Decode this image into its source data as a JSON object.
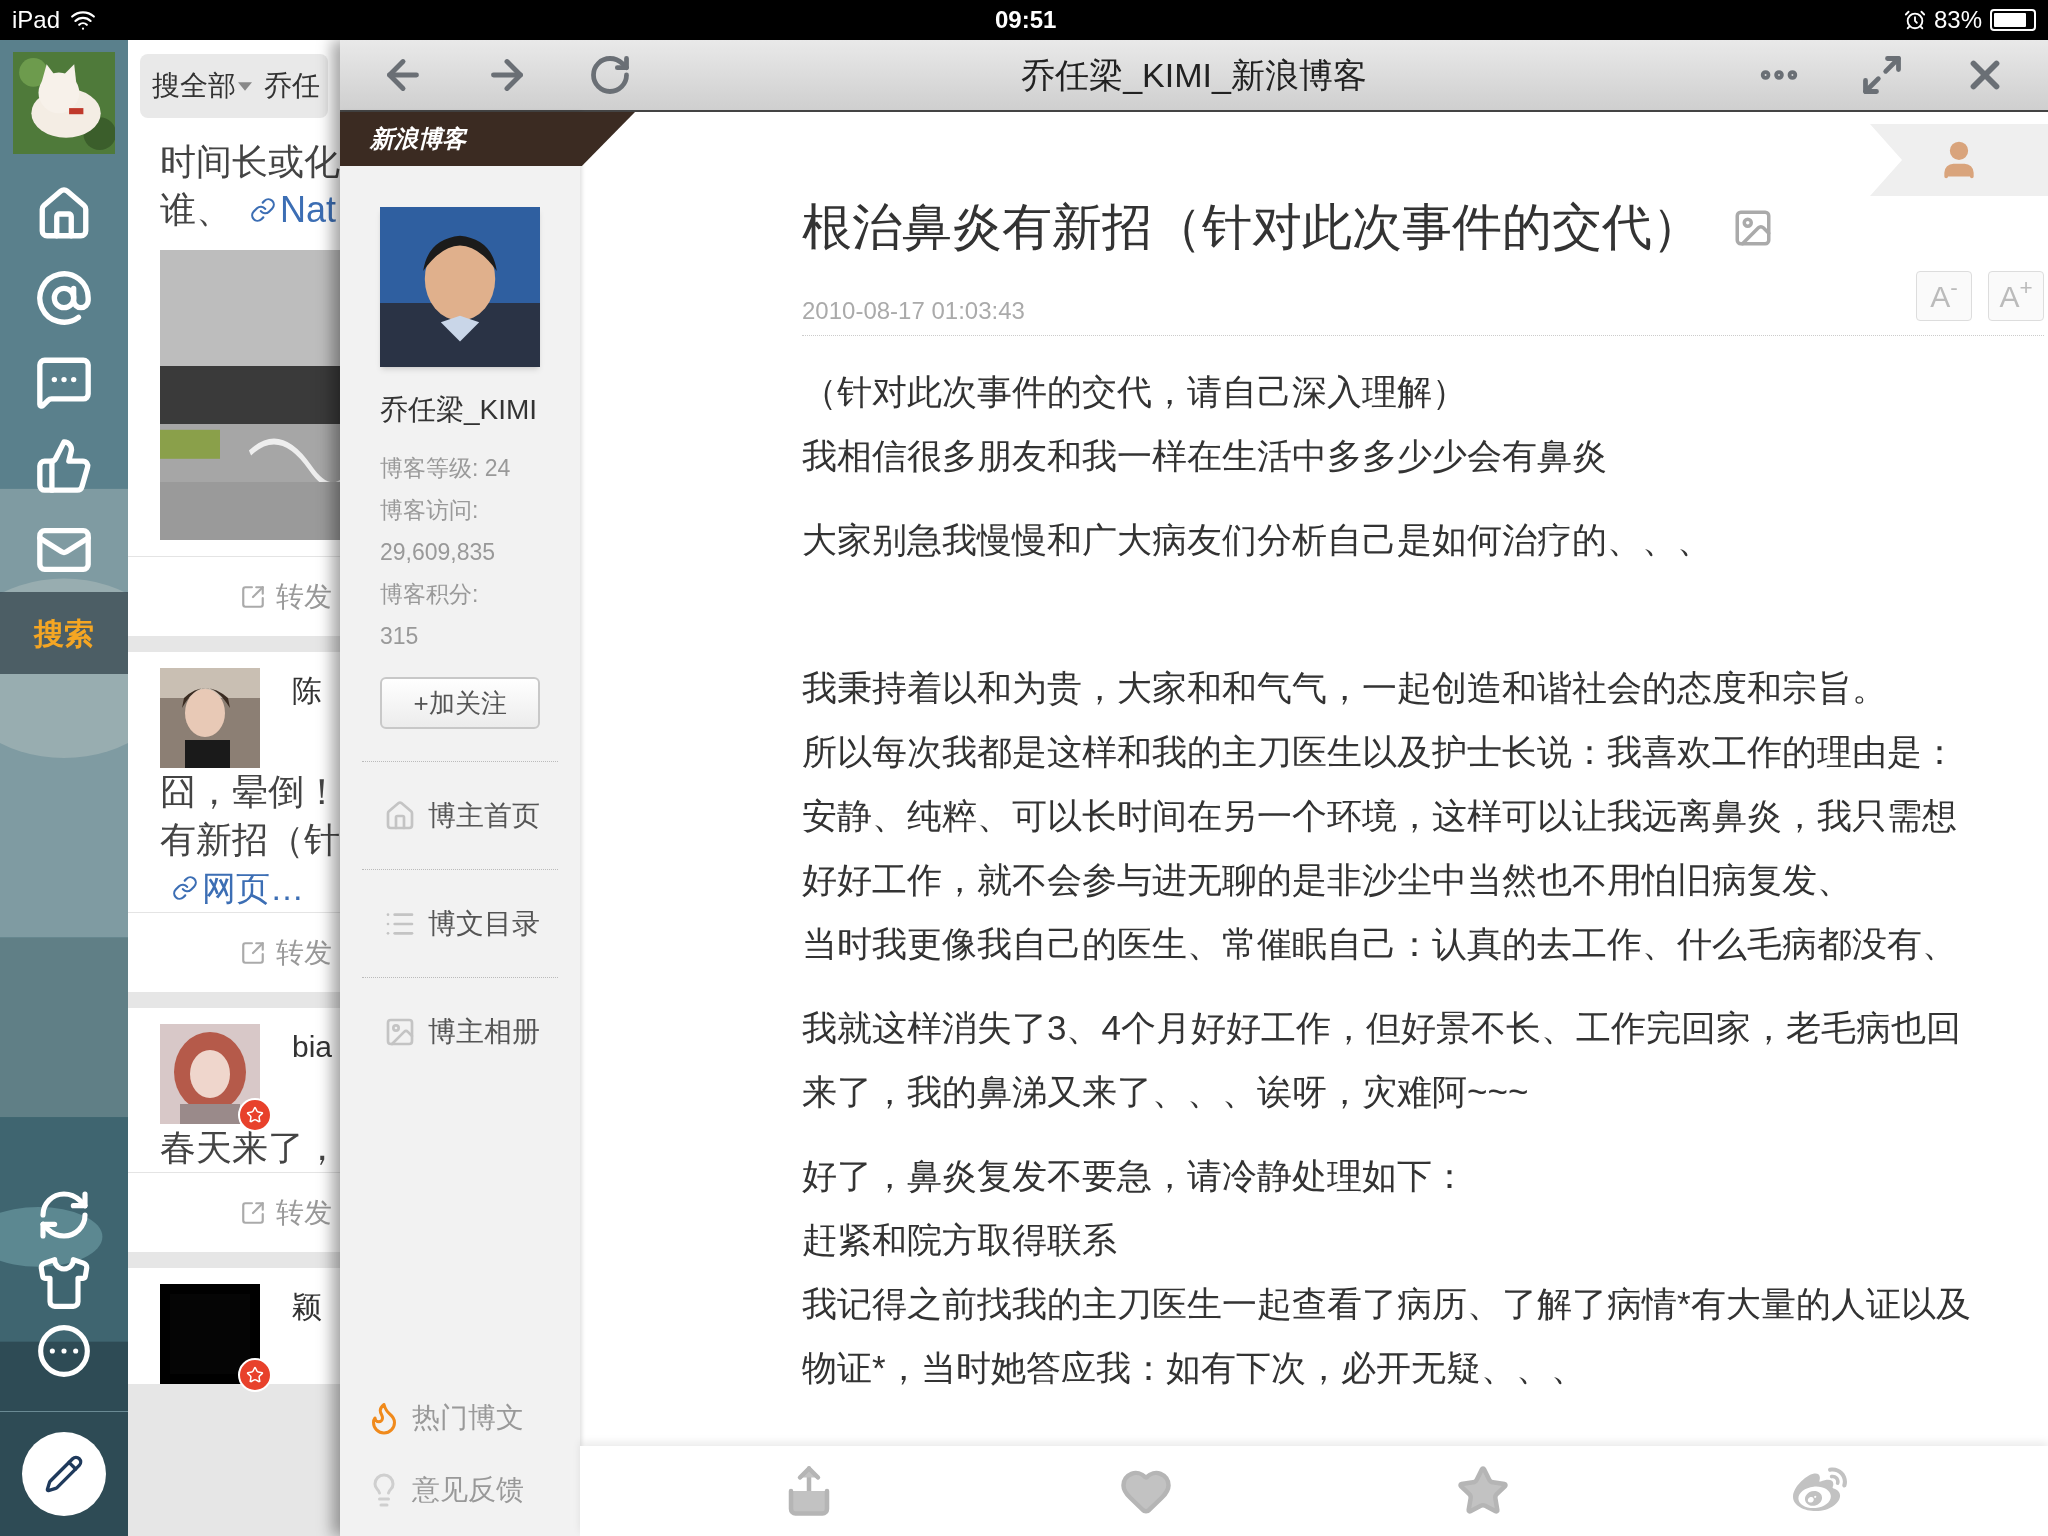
{
  "status_bar": {
    "device": "iPad",
    "time": "09:51",
    "battery": "83%"
  },
  "nav": [
    {
      "kind": "home",
      "selected": false
    },
    {
      "kind": "mention",
      "selected": false
    },
    {
      "kind": "messages",
      "selected": false
    },
    {
      "kind": "likes",
      "selected": false
    },
    {
      "kind": "mail",
      "selected": false
    },
    {
      "kind": "search",
      "label": "搜索",
      "selected": true
    }
  ],
  "nav_bottom": [
    {
      "kind": "refresh"
    },
    {
      "kind": "theme"
    },
    {
      "kind": "more"
    }
  ],
  "feed": {
    "scope": "搜全部",
    "query": "乔任",
    "posts": [
      {
        "kind": "text",
        "lines": [
          {
            "text": "时间长或化"
          },
          {
            "text": "谁、",
            "link": "Nat"
          }
        ],
        "has_picture": true,
        "repost": "转发"
      },
      {
        "author": "陈",
        "verified": false,
        "lines": [
          {
            "text": "囧，晕倒！"
          },
          {
            "text": "有新招（针"
          },
          {
            "link": "网页…"
          }
        ],
        "repost": "转发"
      },
      {
        "author": "bia",
        "verified": true,
        "lines": [
          {
            "text": "春天来了，"
          }
        ],
        "repost": "转发"
      },
      {
        "kind": "dark",
        "author": "颖",
        "verified": true
      }
    ]
  },
  "browser": {
    "title": "乔任梁_KIMI_新浪博客"
  },
  "blog": {
    "brand": "新浪博客",
    "name": "乔任梁_KIMI",
    "stats": [
      "博客等级: 24",
      "博客访问:",
      "29,609,835",
      "博客积分:",
      "315"
    ],
    "follow": "+加关注",
    "menu": [
      {
        "kind": "home",
        "label": "博主首页"
      },
      {
        "kind": "list",
        "label": "博文目录"
      },
      {
        "kind": "album",
        "label": "博主相册"
      }
    ],
    "bottom_links": [
      {
        "kind": "hot",
        "label": "热门博文"
      },
      {
        "kind": "feedback",
        "label": "意见反馈"
      }
    ]
  },
  "article": {
    "title": "根治鼻炎有新招（针对此次事件的交代）",
    "date": "2010-08-17 01:03:43",
    "font_buttons": [
      "A$^{-}$",
      "A$^{+}$"
    ],
    "blocks": [
      {
        "blank_line_before": false,
        "lines": [
          "（针对此次事件的交代，请自己深入理解）",
          "我相信很多朋友和我一样在生活中多多少少会有鼻炎"
        ]
      },
      {
        "blank_line_before": false,
        "lines": [
          "大家别急我慢慢和广大病友们分析自己是如何治疗的、、、"
        ]
      },
      {
        "blank_line_before": true,
        "lines": [
          "我秉持着以和为贵，大家和和气气，一起创造和谐社会的态度和宗旨。",
          "所以每次我都是这样和我的主刀医生以及护士长说：我喜欢工作的理由是：",
          "安静、纯粹、可以长时间在另一个环境，这样可以让我远离鼻炎，我只需想",
          "好好工作，就不会参与进无聊的是非沙尘中当然也不用怕旧病复发、",
          "当时我更像我自己的医生、常催眠自己：认真的去工作、什么毛病都没有、"
        ]
      },
      {
        "blank_line_before": false,
        "lines": [
          "我就这样消失了3、4个月好好工作，但好景不长、工作完回家，老毛病也回",
          "来了，我的鼻涕又来了、、、诶呀，灾难阿~~~"
        ]
      },
      {
        "blank_line_before": false,
        "lines": [
          "好了，鼻炎复发不要急，请冷静处理如下：",
          "赶紧和院方取得联系",
          "我记得之前找我的主刀医生一起查看了病历、了解了病情*有大量的人证以及",
          "物证*，当时她答应我：如有下次，必开无疑、、、"
        ]
      }
    ]
  },
  "actions": [
    {
      "kind": "share"
    },
    {
      "kind": "like"
    },
    {
      "kind": "favorite"
    },
    {
      "kind": "weibo"
    }
  ]
}
